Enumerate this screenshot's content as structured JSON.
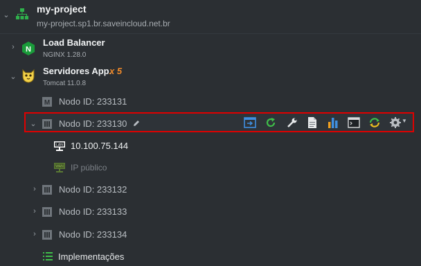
{
  "env": {
    "name": "my-project",
    "domain": "my-project.sp1.br.saveincloud.net.br"
  },
  "load_balancer": {
    "name": "Load Balancer",
    "version": "NGINX 1.28.0",
    "icon": "nginx-icon"
  },
  "app_servers": {
    "name": "Servidores App.",
    "count": "x 5",
    "version": "Tomcat 11.0.8",
    "icon": "tomcat-icon"
  },
  "nodes": [
    {
      "label": "Nodo ID: 233131",
      "icon": "master-node-icon"
    },
    {
      "label": "Nodo ID: 233130",
      "icon": "node-icon",
      "selected": true
    },
    {
      "label": "Nodo ID: 233132",
      "icon": "node-icon"
    },
    {
      "label": "Nodo ID: 233133",
      "icon": "node-icon"
    },
    {
      "label": "Nodo ID: 233134",
      "icon": "node-icon"
    }
  ],
  "selected_node_children": {
    "lan_ip": "10.100.75.144",
    "public_ip": "IP público"
  },
  "deployments": {
    "label": "Implementações"
  },
  "toolbar_icons": [
    "open-in-browser-icon",
    "restart-icon",
    "config-wrench-icon",
    "log-file-icon",
    "statistics-icon",
    "web-ssh-icon",
    "redeploy-icon",
    "settings-gear-icon"
  ],
  "colors": {
    "background": "#2b2f33",
    "highlight_border": "#e00000",
    "count_accent": "#f08a2a",
    "nginx_green": "#1a9b3a",
    "env_icon_green": "#2fb24c"
  }
}
